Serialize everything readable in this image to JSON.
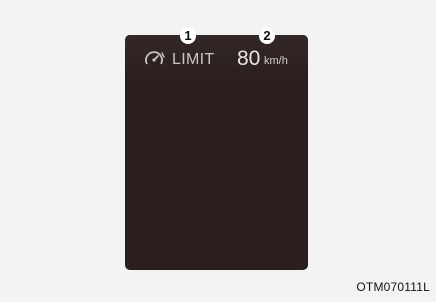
{
  "display": {
    "limit_icon": "speed-limiter-gauge-icon",
    "limit_label": "LIMIT",
    "speed_value": "80",
    "speed_unit": "km/h"
  },
  "callouts": [
    {
      "number": "1"
    },
    {
      "number": "2"
    }
  ],
  "figure_code": "OTM070111L",
  "colors": {
    "page_background": "#f3f3f3",
    "panel_background": "#2b1e1e",
    "text_light": "#d0d0d0"
  }
}
